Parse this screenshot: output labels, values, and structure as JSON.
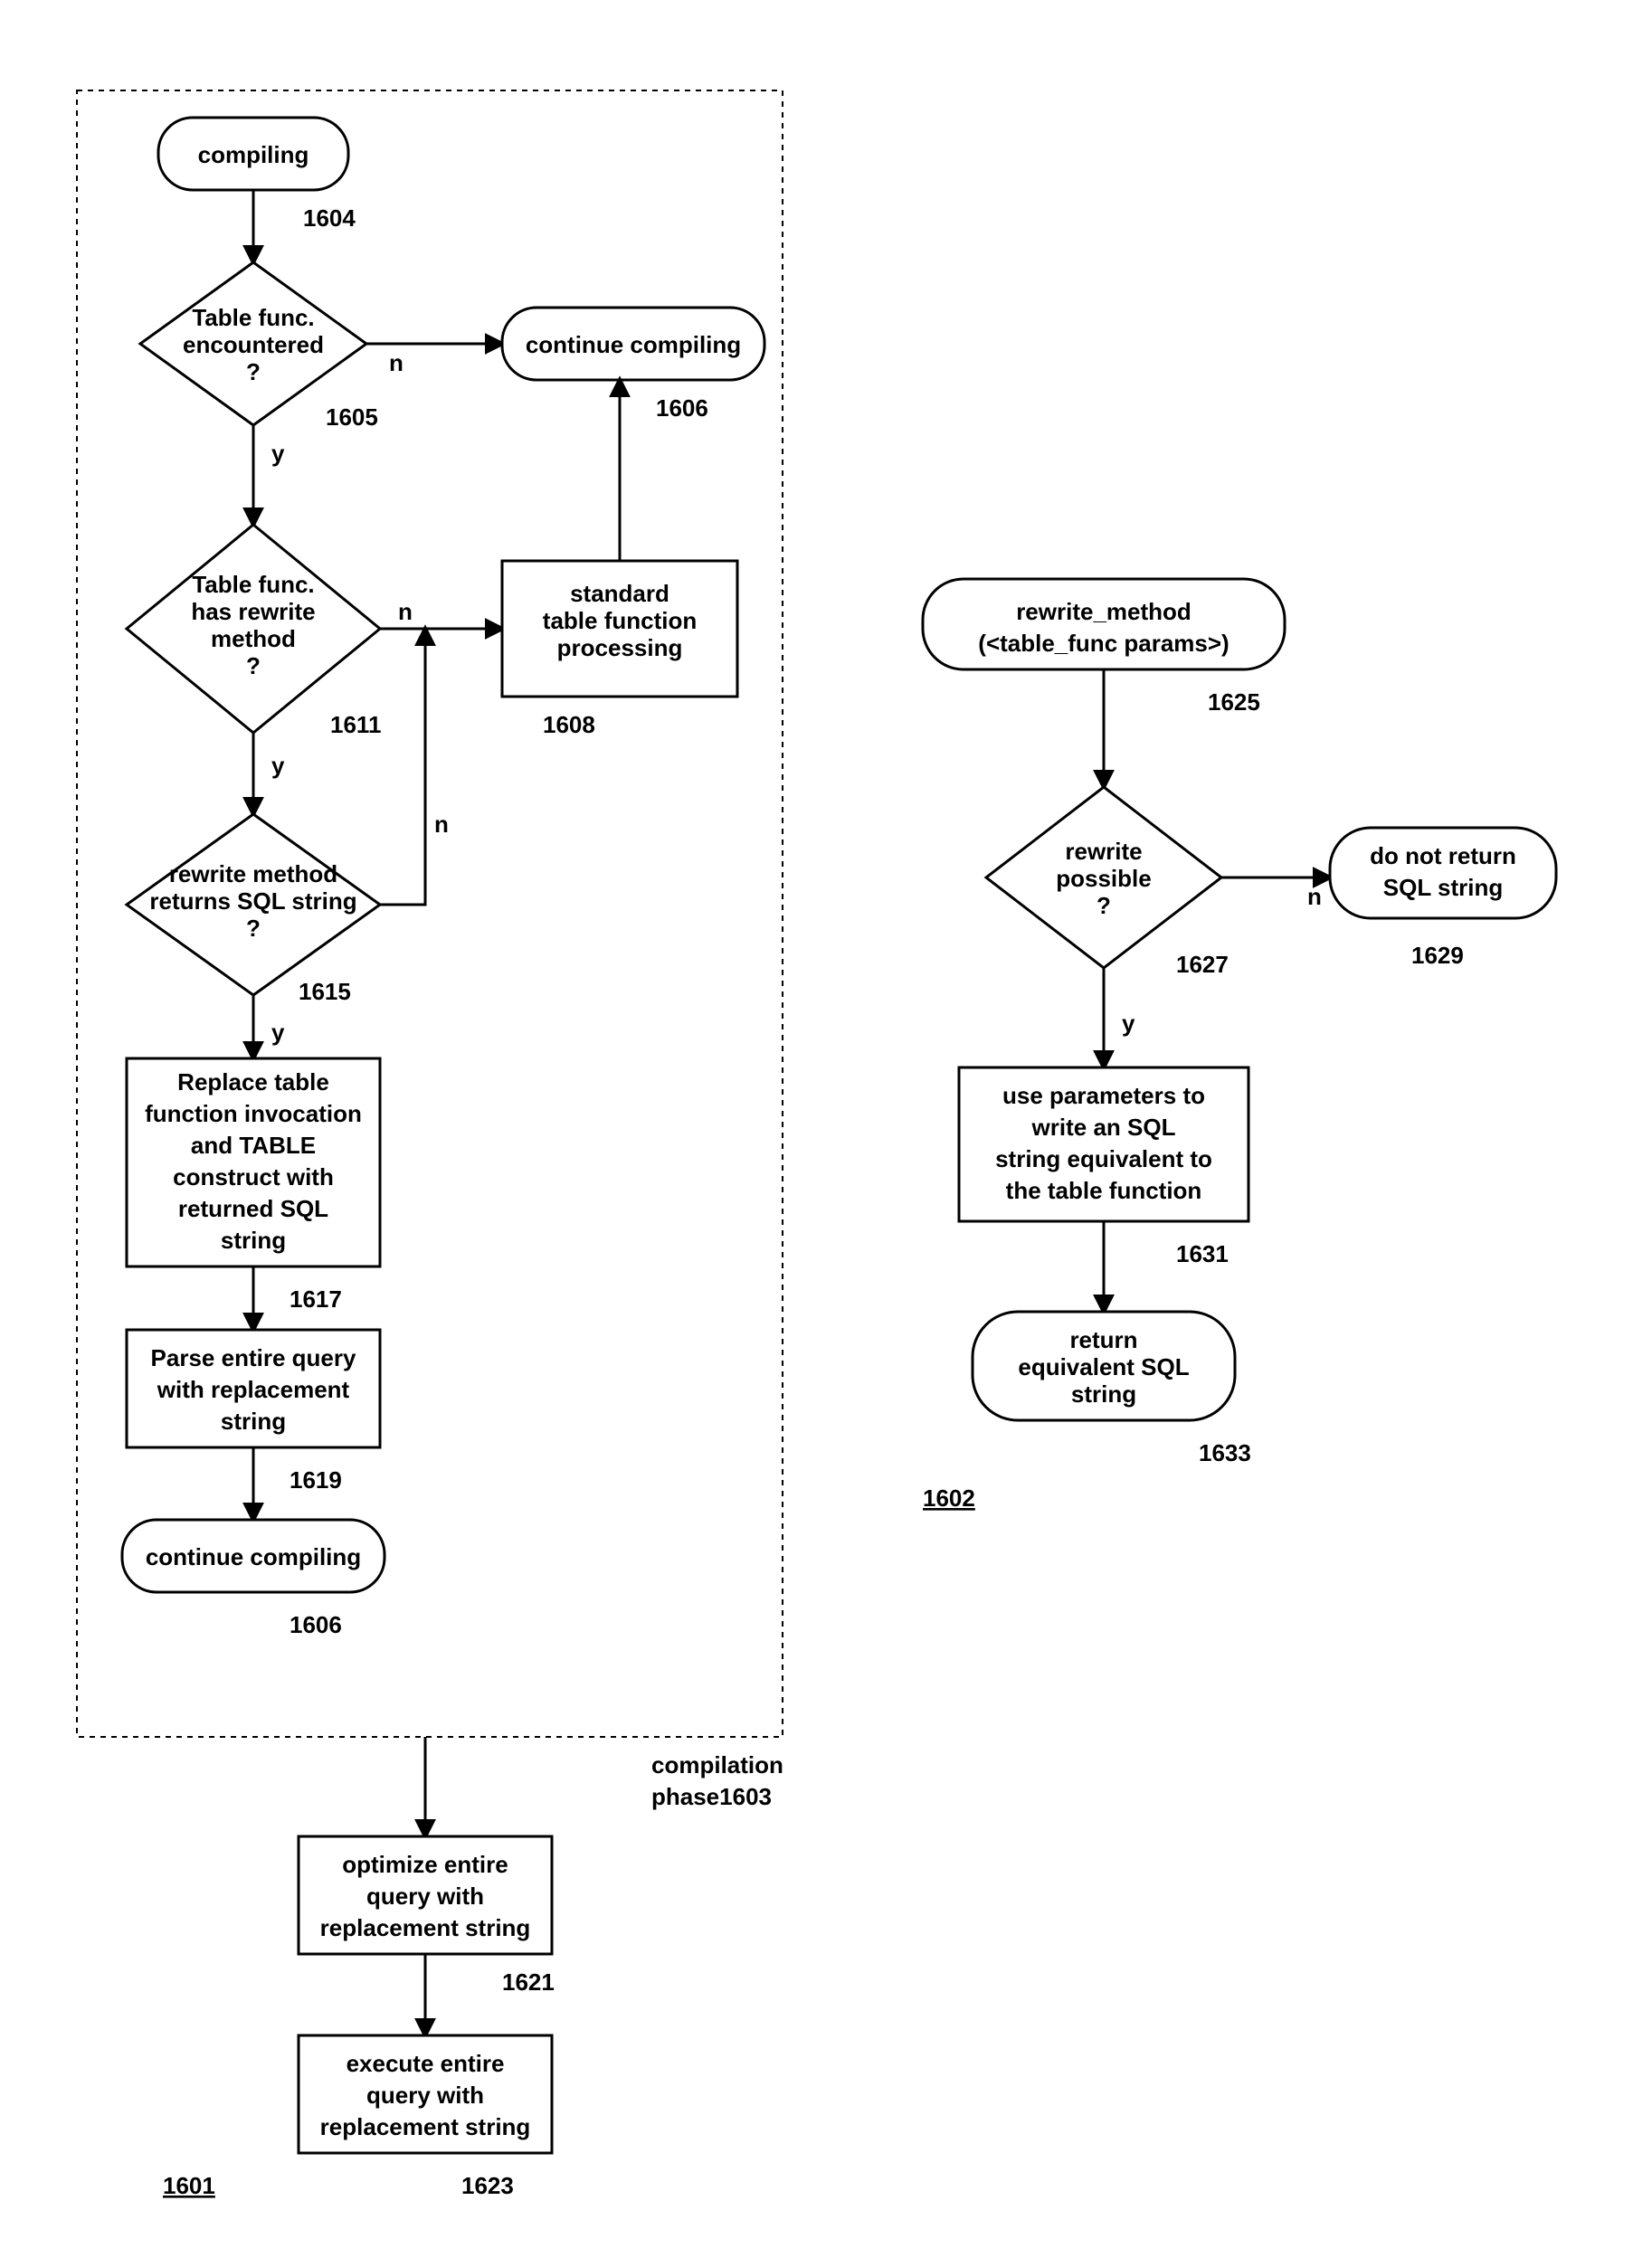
{
  "left": {
    "compiling": "compiling",
    "compiling_ref": "1604",
    "d1": "Table func.\nencountered\n?",
    "d1_ref": "1605",
    "d1_y": "y",
    "d1_n": "n",
    "cont1": "continue compiling",
    "cont1_ref": "1606",
    "d2": "Table func.\nhas rewrite\nmethod\n?",
    "d2_ref": "1611",
    "d2_y": "y",
    "d2_n": "n",
    "std": "standard\ntable function\nprocessing",
    "std_ref": "1608",
    "d3": "rewrite method\nreturns SQL string\n?",
    "d3_ref": "1615",
    "d3_y": "y",
    "d3_n": "n",
    "replace": "Replace table\nfunction invocation\nand TABLE\nconstruct with\nreturned SQL\nstring",
    "replace_ref": "1617",
    "parse": "Parse entire query\nwith replacement\nstring",
    "parse_ref": "1619",
    "cont2": "continue compiling",
    "cont2_ref": "1606",
    "phase": "compilation\nphase1603",
    "opt": "optimize entire\nquery with\nreplacement string",
    "opt_ref": "1621",
    "exec": "execute entire\nquery with\nreplacement string",
    "exec_ref": "1623",
    "left_fig_ref": "1601"
  },
  "right": {
    "start": "rewrite_method\n(<table_func params>)",
    "start_ref": "1625",
    "d1": "rewrite\npossible\n?",
    "d1_ref": "1627",
    "d1_y": "y",
    "d1_n": "n",
    "noret": "do not return\nSQL string",
    "noret_ref": "1629",
    "use": "use parameters to\nwrite an SQL\nstring equivalent to\nthe table function",
    "use_ref": "1631",
    "ret": "return\nequivalent SQL\nstring",
    "ret_ref": "1633",
    "right_fig_ref": "1602"
  }
}
